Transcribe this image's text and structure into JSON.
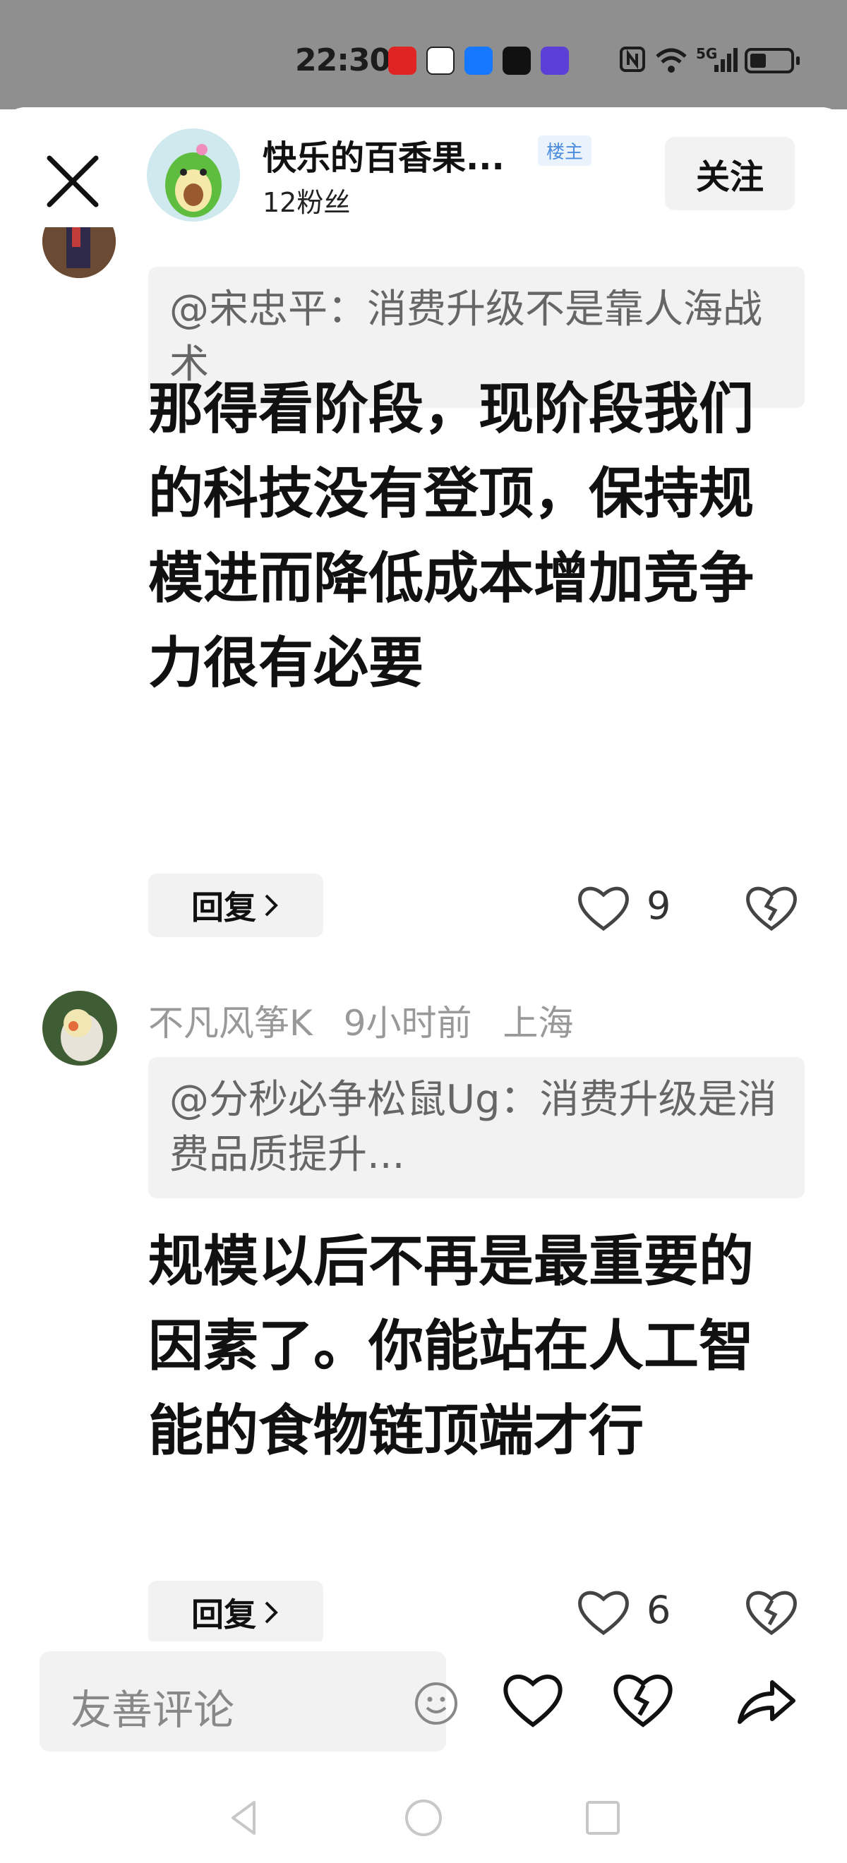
{
  "status_bar": {
    "time": "22:30",
    "network": "5G"
  },
  "header": {
    "owner_name": "快乐的百香果...",
    "owner_tag": "楼主",
    "fans": "12粉丝",
    "follow_label": "关注"
  },
  "comments": [
    {
      "quote": "@宋忠平：消费升级不是靠人海战术",
      "body": "那得看阶段，现阶段我们的科技没有登顶，保持规模进而降低成本增加竞争力很有必要",
      "reply_label": "回复",
      "likes": "9"
    },
    {
      "author": "不凡风筝K",
      "time_ago": "9小时前",
      "location": "上海",
      "quote": "@分秒必争松鼠Ug：消费升级是消费品质提升...",
      "body": "规模以后不再是最重要的因素了。你能站在人工智能的食物链顶端才行",
      "reply_label": "回复",
      "likes": "6"
    }
  ],
  "bottom_bar": {
    "input_placeholder": "友善评论"
  },
  "icons": {
    "close": "close-icon",
    "like": "heart-icon",
    "dislike": "broken-heart-icon",
    "share": "share-icon",
    "emoji": "emoji-icon",
    "nav_back": "back-triangle-icon",
    "nav_home": "home-circle-icon",
    "nav_recent": "recent-square-icon"
  }
}
